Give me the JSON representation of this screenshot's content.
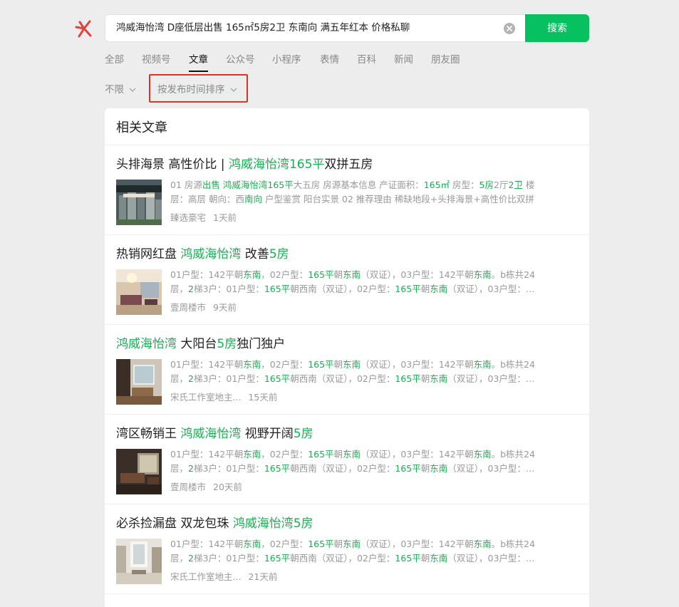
{
  "search": {
    "query": "鸿威海怡湾 D座低层出售 165㎡5房2卫 东南向 满五年红本 价格私聊",
    "button_label": "搜索"
  },
  "tabs": [
    {
      "label": "全部",
      "active": false
    },
    {
      "label": "视频号",
      "active": false
    },
    {
      "label": "文章",
      "active": true
    },
    {
      "label": "公众号",
      "active": false
    },
    {
      "label": "小程序",
      "active": false
    },
    {
      "label": "表情",
      "active": false
    },
    {
      "label": "百科",
      "active": false
    },
    {
      "label": "新闻",
      "active": false
    },
    {
      "label": "朋友圈",
      "active": false
    }
  ],
  "filters": {
    "time_range": "不限",
    "sort": "按发布时间排序"
  },
  "section_title": "相关文章",
  "colors": {
    "accent": "#07c160",
    "highlight_text": "#1aad52",
    "annotation_box": "#d9342b"
  },
  "articles": [
    {
      "title_parts": [
        {
          "text": "头排海景 高性价比 | ",
          "hl": false
        },
        {
          "text": "鸿威海怡湾165平",
          "hl": true
        },
        {
          "text": "双拼五房",
          "hl": false
        }
      ],
      "snippet_lines": [
        [
          {
            "text": "01 房源",
            "hl": false
          },
          {
            "text": "出售",
            "hl": true
          },
          {
            "text": " ",
            "hl": false
          },
          {
            "text": "鸿威海怡湾165平",
            "hl": true
          },
          {
            "text": "大五房 房源基本信息 产证面积：",
            "hl": false
          },
          {
            "text": "165㎡",
            "hl": true
          },
          {
            "text": " 房型：",
            "hl": false
          },
          {
            "text": "5房",
            "hl": true
          },
          {
            "text": "2厅",
            "hl": false
          },
          {
            "text": "2卫",
            "hl": true
          },
          {
            "text": " 楼",
            "hl": false
          }
        ],
        [
          {
            "text": "层：高层 朝向：西",
            "hl": false
          },
          {
            "text": "南向",
            "hl": true
          },
          {
            "text": " 户型鉴赏 阳台实景 02 推荐理由 稀缺地段+头排海景+高性价比双拼",
            "hl": false
          }
        ]
      ],
      "source": "臻选豪宅",
      "time": "1天前",
      "thumb": "poster"
    },
    {
      "title_parts": [
        {
          "text": "热销网红盘 ",
          "hl": false
        },
        {
          "text": "鸿威海怡湾",
          "hl": true
        },
        {
          "text": " 改善",
          "hl": false
        },
        {
          "text": "5房",
          "hl": true
        }
      ],
      "snippet_lines": [
        [
          {
            "text": "01户型：142平朝",
            "hl": false
          },
          {
            "text": "东南",
            "hl": true
          },
          {
            "text": "，02户型：",
            "hl": false
          },
          {
            "text": "165平",
            "hl": true
          },
          {
            "text": "朝",
            "hl": false
          },
          {
            "text": "东南",
            "hl": true
          },
          {
            "text": "（双证），03户型：142平朝",
            "hl": false
          },
          {
            "text": "东南",
            "hl": true
          },
          {
            "text": "。b栋共24",
            "hl": false
          }
        ],
        [
          {
            "text": "层，",
            "hl": false
          },
          {
            "text": "2",
            "hl": true
          },
          {
            "text": "梯3户：01户型：",
            "hl": false
          },
          {
            "text": "165平",
            "hl": true
          },
          {
            "text": "朝西南（双证），02户型：",
            "hl": false
          },
          {
            "text": "165平",
            "hl": true
          },
          {
            "text": "朝",
            "hl": false
          },
          {
            "text": "东南",
            "hl": true
          },
          {
            "text": "（双证），03户型：…",
            "hl": false
          }
        ]
      ],
      "source": "壹周楼市",
      "time": "9天前",
      "thumb": "living"
    },
    {
      "title_parts": [
        {
          "text": "鸿威海怡湾",
          "hl": true
        },
        {
          "text": " 大阳台",
          "hl": false
        },
        {
          "text": "5房",
          "hl": true
        },
        {
          "text": "独门独户",
          "hl": false
        }
      ],
      "snippet_lines": [
        [
          {
            "text": "01户型：142平朝",
            "hl": false
          },
          {
            "text": "东南",
            "hl": true
          },
          {
            "text": "，02户型：",
            "hl": false
          },
          {
            "text": "165平",
            "hl": true
          },
          {
            "text": "朝",
            "hl": false
          },
          {
            "text": "东南",
            "hl": true
          },
          {
            "text": "（双证），03户型：142平朝",
            "hl": false
          },
          {
            "text": "东南",
            "hl": true
          },
          {
            "text": "。b栋共24",
            "hl": false
          }
        ],
        [
          {
            "text": "层，",
            "hl": false
          },
          {
            "text": "2",
            "hl": true
          },
          {
            "text": "梯3户：01户型：",
            "hl": false
          },
          {
            "text": "165平",
            "hl": true
          },
          {
            "text": "朝西南（双证），02户型：",
            "hl": false
          },
          {
            "text": "165平",
            "hl": true
          },
          {
            "text": "朝",
            "hl": false
          },
          {
            "text": "东南",
            "hl": true
          },
          {
            "text": "（双证），03户型：…",
            "hl": false
          }
        ]
      ],
      "source": "宋氏工作室地主...",
      "time": "15天前",
      "thumb": "room"
    },
    {
      "title_parts": [
        {
          "text": "湾区畅销王 ",
          "hl": false
        },
        {
          "text": "鸿威海怡湾",
          "hl": true
        },
        {
          "text": " 视野开阔",
          "hl": false
        },
        {
          "text": "5房",
          "hl": true
        }
      ],
      "snippet_lines": [
        [
          {
            "text": "01户型：142平朝",
            "hl": false
          },
          {
            "text": "东南",
            "hl": true
          },
          {
            "text": "，02户型：",
            "hl": false
          },
          {
            "text": "165平",
            "hl": true
          },
          {
            "text": "朝",
            "hl": false
          },
          {
            "text": "东南",
            "hl": true
          },
          {
            "text": "（双证），03户型：142平朝",
            "hl": false
          },
          {
            "text": "东南",
            "hl": true
          },
          {
            "text": "。b栋共24",
            "hl": false
          }
        ],
        [
          {
            "text": "层，",
            "hl": false
          },
          {
            "text": "2",
            "hl": true
          },
          {
            "text": "梯3户：01户型：",
            "hl": false
          },
          {
            "text": "165平",
            "hl": true
          },
          {
            "text": "朝西南（双证），02户型：",
            "hl": false
          },
          {
            "text": "165平",
            "hl": true
          },
          {
            "text": "朝",
            "hl": false
          },
          {
            "text": "东南",
            "hl": true
          },
          {
            "text": "（双证），03户型：…",
            "hl": false
          }
        ]
      ],
      "source": "壹周楼市",
      "time": "20天前",
      "thumb": "dark"
    },
    {
      "title_parts": [
        {
          "text": "必杀捡漏盘 双龙包珠 ",
          "hl": false
        },
        {
          "text": "鸿威海怡湾5房",
          "hl": true
        }
      ],
      "snippet_lines": [
        [
          {
            "text": "01户型：142平朝",
            "hl": false
          },
          {
            "text": "东南",
            "hl": true
          },
          {
            "text": "，02户型：",
            "hl": false
          },
          {
            "text": "165平",
            "hl": true
          },
          {
            "text": "朝",
            "hl": false
          },
          {
            "text": "东南",
            "hl": true
          },
          {
            "text": "（双证），03户型：142平朝",
            "hl": false
          },
          {
            "text": "东南",
            "hl": true
          },
          {
            "text": "。b栋共24",
            "hl": false
          }
        ],
        [
          {
            "text": "层，",
            "hl": false
          },
          {
            "text": "2",
            "hl": true
          },
          {
            "text": "梯3户：01户型：",
            "hl": false
          },
          {
            "text": "165平",
            "hl": true
          },
          {
            "text": "朝西南（双证），02户型：",
            "hl": false
          },
          {
            "text": "165平",
            "hl": true
          },
          {
            "text": "朝",
            "hl": false
          },
          {
            "text": "东南",
            "hl": true
          },
          {
            "text": "（双证），03户型：…",
            "hl": false
          }
        ]
      ],
      "source": "宋氏工作室地主...",
      "time": "21天前",
      "thumb": "bright"
    }
  ]
}
